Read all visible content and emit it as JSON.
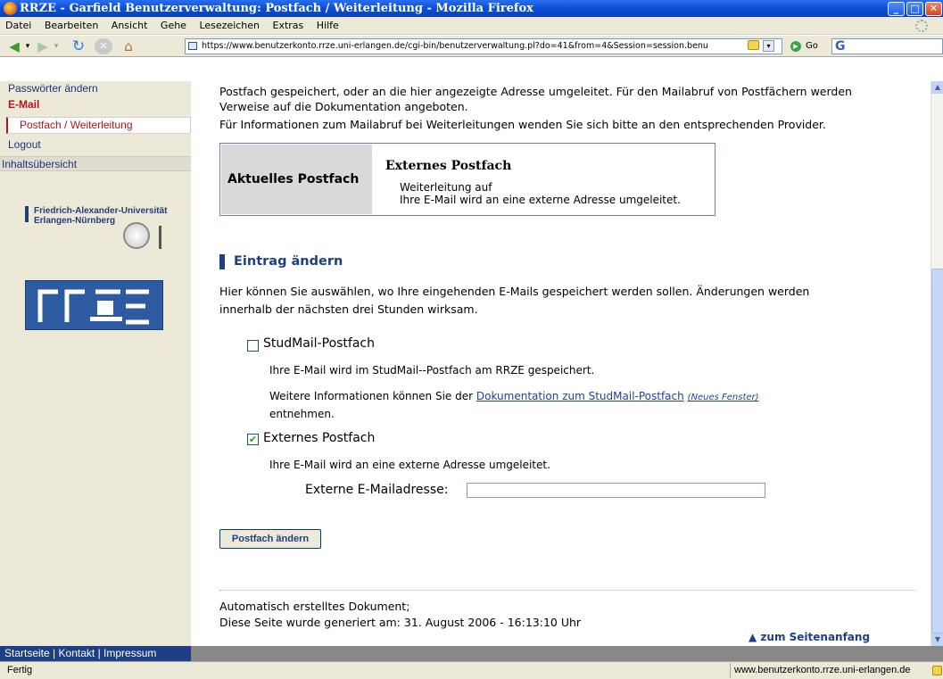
{
  "window": {
    "title": "RRZE - Garfield Benutzerverwaltung: Postfach / Weiterleitung - Mozilla Firefox"
  },
  "menu": [
    "Datei",
    "Bearbeiten",
    "Ansicht",
    "Gehe",
    "Lesezeichen",
    "Extras",
    "Hilfe"
  ],
  "toolbar": {
    "url": "https://www.benutzerkonto.rrze.uni-erlangen.de/cgi-bin/benutzerverwaltung.pl?do=41&from=4&Session=session.benu",
    "go_label": "Go",
    "search_value": ""
  },
  "sidebar": {
    "items": {
      "passwords": "Passwörter ändern",
      "email": "E-Mail",
      "postfach": "Postfach / Weiterleitung",
      "logout": "Logout",
      "contents": "Inhaltsübersicht"
    },
    "fau_line1": "Friedrich-Alexander-Universität",
    "fau_line2": "Erlangen-Nürnberg"
  },
  "content": {
    "intro1": "Postfach gespeichert, oder an die hier angezeigte Adresse umgeleitet. Für den Mailabruf von Postfächern werden",
    "intro2": "Verweise auf die Dokumentation angeboten.",
    "intro3": "Für Informationen zum Mailabruf bei Weiterleitungen wenden Sie sich bitte an den entsprechenden Provider.",
    "current_box": {
      "left_label": "Aktuelles Postfach",
      "title": "Externes Postfach",
      "line1": "Weiterleitung auf",
      "line2": "Ihre E-Mail wird an eine externe Adresse umgeleitet."
    },
    "section_title": "Eintrag ändern",
    "desc1": "Hier können Sie auswählen, wo Ihre eingehenden E-Mails gespeichert werden sollen. Änderungen werden",
    "desc2": "innerhalb der nächsten drei Stunden wirksam.",
    "options": {
      "studmail": {
        "label": "StudMail-Postfach",
        "checked": false,
        "desc": "Ihre E-Mail wird im StudMail--Postfach am RRZE gespeichert.",
        "info_prefix": "Weitere Informationen können Sie der",
        "info_link": "Dokumentation zum StudMail-Postfach",
        "info_new_window": "(Neues Fenster)",
        "info_suffix": "entnehmen."
      },
      "external": {
        "label": "Externes Postfach",
        "checked": true,
        "desc": "Ihre E-Mail wird an eine externe Adresse umgeleitet.",
        "address_label": "Externe E-Mailadresse:",
        "address_value": ""
      }
    },
    "submit_label": "Postfach ändern",
    "footer1": "Automatisch erstelltes Dokument;",
    "footer2": "Diese Seite wurde generiert am: 31. August 2006 - 16:13:10 Uhr",
    "top_link": "zum Seitenanfang",
    "top_link_icon": "▲"
  },
  "bottom_nav": {
    "start": "Startseite",
    "contact": "Kontakt",
    "imprint": "Impressum",
    "separator": "|"
  },
  "statusbar": {
    "text": "Fertig",
    "host": "www.benutzerkonto.rrze.uni-erlangen.de"
  }
}
